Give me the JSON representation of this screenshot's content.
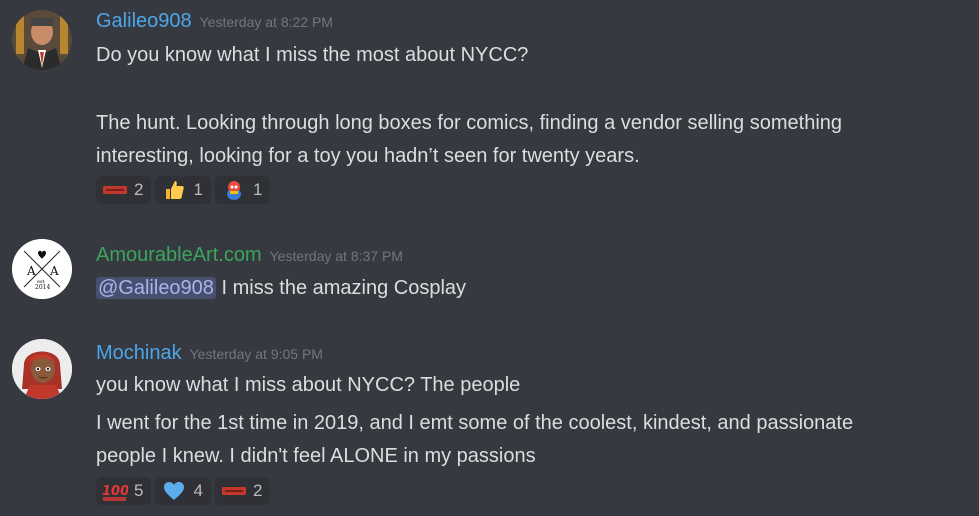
{
  "colors": {
    "background": "#36393f",
    "reaction_bg": "#2f3136",
    "text": "#dcddde",
    "timestamp": "#72767d",
    "mention_bg": "#4a5080",
    "mention_text": "#a6b6ec"
  },
  "messages": [
    {
      "username": "Galileo908",
      "username_color": "#4da6e8",
      "timestamp": "Yesterday at 8:22 PM",
      "avatar_icon": "galileo-avatar-icon",
      "lines": [
        "Do you know what I miss the most about NYCC?",
        "The hunt. Looking through long boxes for comics, finding a vendor selling something",
        "interesting, looking for a toy you hadn’t seen for twenty years."
      ],
      "reactions": [
        {
          "icon": "nycc-logo-icon",
          "count": "2"
        },
        {
          "icon": "thumbs-up-icon",
          "count": "1"
        },
        {
          "icon": "character-emoji-icon",
          "count": "1"
        }
      ]
    },
    {
      "username": "AmourableArt.com",
      "username_color": "#3ba55c",
      "timestamp": "Yesterday at 8:37 PM",
      "avatar_icon": "amourable-art-logo-icon",
      "avatar_text": {
        "left_letter": "A",
        "right_letter": "A",
        "est": "est",
        "year": "2014"
      },
      "mention": "@Galileo908",
      "text": "I miss the amazing Cosplay"
    },
    {
      "username": "Mochinak",
      "username_color": "#4da6e8",
      "timestamp": "Yesterday at 9:05 PM",
      "avatar_icon": "mochinak-avatar-icon",
      "lines": [
        "you know what I miss about NYCC? The people",
        "I went for the 1st time in 2019, and I emt some of the coolest, kindest, and passionate",
        "people I knew. I didn't feel ALONE in my passions"
      ],
      "reactions": [
        {
          "icon": "hundred-points-icon",
          "count": "5"
        },
        {
          "icon": "blue-heart-icon",
          "count": "4"
        },
        {
          "icon": "nycc-logo-icon",
          "count": "2"
        }
      ]
    }
  ]
}
